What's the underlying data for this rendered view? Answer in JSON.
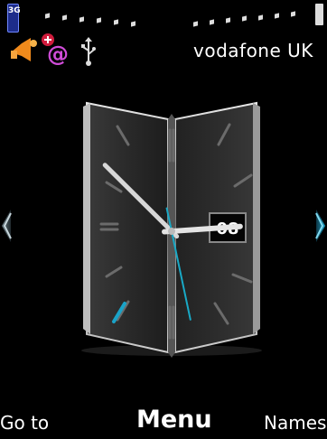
{
  "status_bar": {
    "network_type": "3G",
    "operator": "vodafone UK"
  },
  "icons": [
    "profile-notify-icon",
    "email-icon",
    "usb-icon"
  ],
  "clock": {
    "date_day": "08",
    "hour": 2,
    "minute": 52,
    "second": 28
  },
  "softkeys": {
    "left": "Go to",
    "center": "Menu",
    "right": "Names"
  },
  "colors": {
    "second_hand": "#19a9c6",
    "accent": "#2a9fd0"
  }
}
